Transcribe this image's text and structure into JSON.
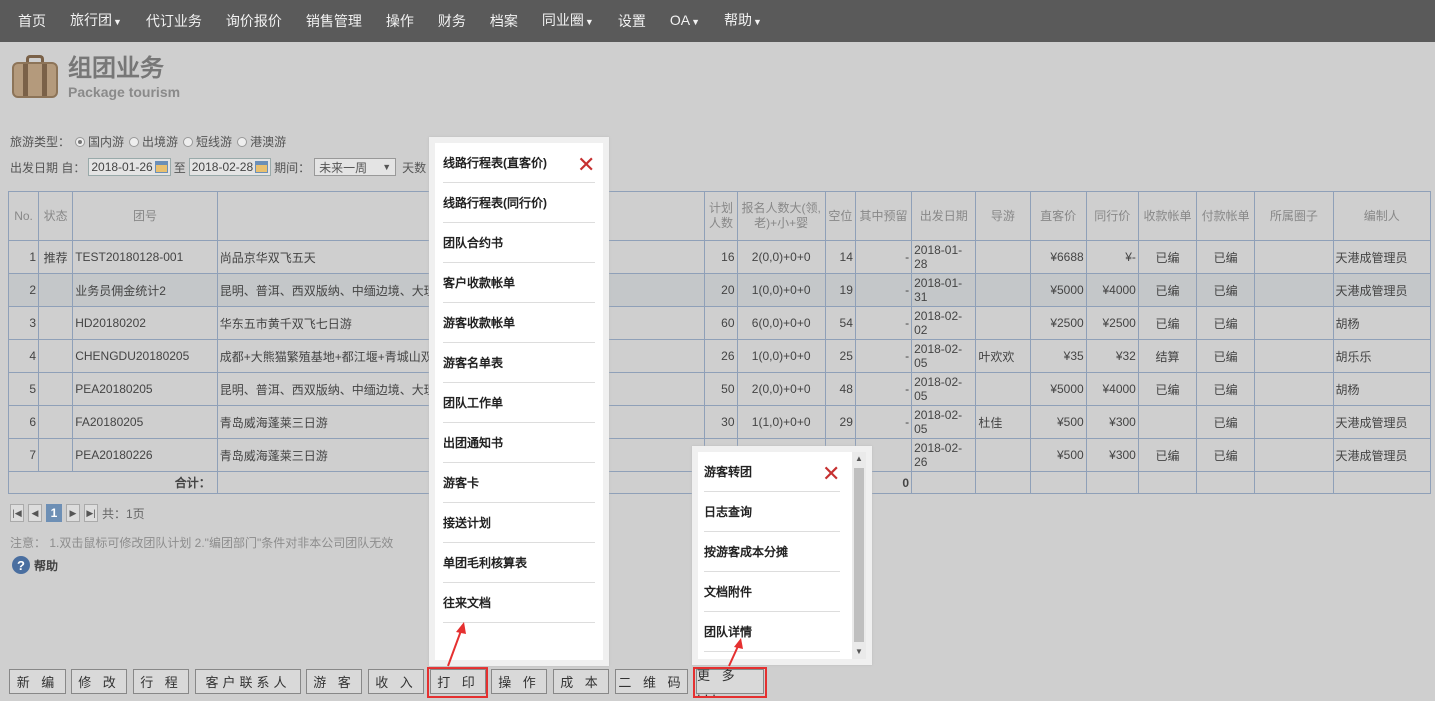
{
  "nav": [
    {
      "label": "首页",
      "caret": false
    },
    {
      "label": "旅行团",
      "caret": true
    },
    {
      "label": "代订业务",
      "caret": false
    },
    {
      "label": "询价报价",
      "caret": false
    },
    {
      "label": "销售管理",
      "caret": false
    },
    {
      "label": "操作",
      "caret": false
    },
    {
      "label": "财务",
      "caret": false
    },
    {
      "label": "档案",
      "caret": false
    },
    {
      "label": "同业圈",
      "caret": true
    },
    {
      "label": "设置",
      "caret": false
    },
    {
      "label": "OA",
      "caret": true
    },
    {
      "label": "帮助",
      "caret": true
    }
  ],
  "header": {
    "title_cn": "组团业务",
    "title_en": "Package tourism"
  },
  "filters": {
    "type_label": "旅游类型：",
    "types": [
      "国内游",
      "出境游",
      "短线游",
      "港澳游"
    ],
    "selected_type": "国内游",
    "date_label": "出发日期 自：",
    "date_from": "2018-01-26",
    "to_label": "至",
    "date_to": "2018-02-28",
    "period_label": "期间：",
    "period_value": "未来一周",
    "days_label": "天数"
  },
  "table": {
    "headers": [
      "No.",
      "状态",
      "团号",
      "",
      "计划人数",
      "报名人数大(领,老)+小+婴",
      "空位",
      "其中预留",
      "出发日期",
      "导游",
      "直客价",
      "同行价",
      "收款帐单",
      "付款帐单",
      "所属圈子",
      "编制人"
    ],
    "rows": [
      {
        "no": "1",
        "status": "推荐",
        "code": "TEST20180128-001",
        "route": "尚品京华双飞五天",
        "plan": "16",
        "signup": "2(0,0)+0+0",
        "vacant": "14",
        "reserved": "-",
        "date": "2018-01-28",
        "guide": "",
        "direct": "¥6688",
        "trade": "¥-",
        "receipt": "已编",
        "payment": "已编",
        "circle": "",
        "creator": "天港成管理员"
      },
      {
        "no": "2",
        "status": "",
        "code": "业务员佣金统计2",
        "route": "昆明、普洱、西双版纳、中缅边境、大理",
        "plan": "20",
        "signup": "1(0,0)+0+0",
        "vacant": "19",
        "reserved": "-",
        "date": "2018-01-31",
        "guide": "",
        "direct": "¥5000",
        "trade": "¥4000",
        "receipt": "已编",
        "payment": "已编",
        "circle": "",
        "creator": "天港成管理员"
      },
      {
        "no": "3",
        "status": "",
        "code": "HD20180202",
        "route": "华东五市黄千双飞七日游",
        "plan": "60",
        "signup": "6(0,0)+0+0",
        "vacant": "54",
        "reserved": "-",
        "date": "2018-02-02",
        "guide": "",
        "direct": "¥2500",
        "trade": "¥2500",
        "receipt": "已编",
        "payment": "已编",
        "circle": "",
        "creator": "胡杨"
      },
      {
        "no": "4",
        "status": "",
        "code": "CHENGDU20180205",
        "route": "成都+大熊猫繁殖基地+都江堰+青城山双",
        "plan": "26",
        "signup": "1(0,0)+0+0",
        "vacant": "25",
        "reserved": "-",
        "date": "2018-02-05",
        "guide": "叶欢欢",
        "direct": "¥35",
        "trade": "¥32",
        "receipt": "结算",
        "payment": "已编",
        "circle": "",
        "creator": "胡乐乐"
      },
      {
        "no": "5",
        "status": "",
        "code": "PEA20180205",
        "route": "昆明、普洱、西双版纳、中缅边境、大理",
        "plan": "50",
        "signup": "2(0,0)+0+0",
        "vacant": "48",
        "reserved": "-",
        "date": "2018-02-05",
        "guide": "",
        "direct": "¥5000",
        "trade": "¥4000",
        "receipt": "已编",
        "payment": "已编",
        "circle": "",
        "creator": "胡杨"
      },
      {
        "no": "6",
        "status": "",
        "code": "FA20180205",
        "route": "青岛威海蓬莱三日游",
        "plan": "30",
        "signup": "1(1,0)+0+0",
        "vacant": "29",
        "reserved": "-",
        "date": "2018-02-05",
        "guide": "杜佳",
        "direct": "¥500",
        "trade": "¥300",
        "receipt": "",
        "payment": "已编",
        "circle": "",
        "creator": "天港成管理员"
      },
      {
        "no": "7",
        "status": "",
        "code": "PEA20180226",
        "route": "青岛威海蓬莱三日游",
        "plan": "",
        "signup": "",
        "vacant": "",
        "reserved": "",
        "date": "2018-02-26",
        "guide": "",
        "direct": "¥500",
        "trade": "¥300",
        "receipt": "已编",
        "payment": "已编",
        "circle": "",
        "creator": "天港成管理员"
      }
    ],
    "total_label": "合计：",
    "total_reserved": "0"
  },
  "pager": {
    "current": "1",
    "total_text": "共：1页"
  },
  "note": "注意： 1.双击鼠标可修改团队计划   2.\"编团部门\"条件对非本公司团队无效",
  "help_label": "帮助",
  "buttons": [
    "新 编",
    "修 改",
    "行 程",
    "客户联系人",
    "游 客",
    "收 入",
    "打 印",
    "操 作",
    "成 本",
    "二 维 码",
    "更 多 ..."
  ],
  "print_menu": [
    "线路行程表(直客价)",
    "线路行程表(同行价)",
    "团队合约书",
    "客户收款帐单",
    "游客收款帐单",
    "游客名单表",
    "团队工作单",
    "出团通知书",
    "游客卡",
    "接送计划",
    "单团毛利核算表",
    "往来文档"
  ],
  "more_menu": [
    "游客转团",
    "日志查询",
    "按游客成本分摊",
    "文档附件",
    "团队详情"
  ],
  "colors": {
    "nav_bg": "#5a5a5a",
    "highlight": "#e53030",
    "close": "#c63030",
    "pager_active": "#6d8fb5"
  }
}
